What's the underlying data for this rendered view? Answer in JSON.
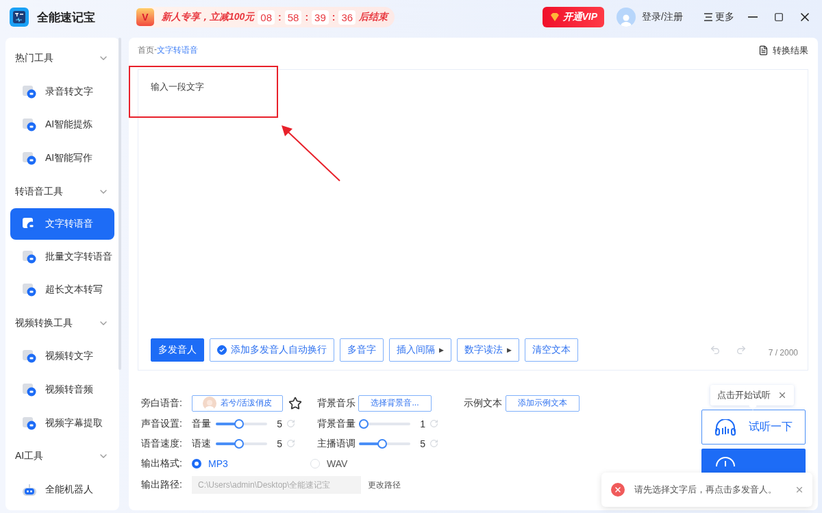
{
  "app": {
    "name": "全能速记宝"
  },
  "promo": {
    "badge": "V",
    "text": "新人专享，立减100元",
    "countdown": [
      {
        "kind": "digits",
        "text": "08"
      },
      {
        "kind": "colon",
        "text": ":"
      },
      {
        "kind": "digits",
        "text": "58"
      },
      {
        "kind": "colon",
        "text": ":"
      },
      {
        "kind": "digits",
        "text": "39"
      },
      {
        "kind": "colon",
        "text": ":"
      },
      {
        "kind": "digits",
        "text": "36"
      }
    ],
    "suffix": "后结束"
  },
  "vip_button": "开通VIP",
  "login": "登录/注册",
  "more_menu": "更多",
  "sidebar": {
    "sections": [
      {
        "title": "热门工具",
        "expanded": true,
        "items": [
          {
            "label": "录音转文字",
            "selected": false
          },
          {
            "label": "AI智能提炼",
            "selected": false
          },
          {
            "label": "AI智能写作",
            "selected": false
          }
        ]
      },
      {
        "title": "转语音工具",
        "expanded": true,
        "items": [
          {
            "label": "文字转语音",
            "selected": true
          },
          {
            "label": "批量文字转语音",
            "selected": false
          },
          {
            "label": "超长文本转写",
            "selected": false
          }
        ]
      },
      {
        "title": "视频转换工具",
        "expanded": true,
        "items": [
          {
            "label": "视频转文字",
            "selected": false
          },
          {
            "label": "视频转音频",
            "selected": false
          },
          {
            "label": "视频字幕提取",
            "selected": false
          }
        ]
      },
      {
        "title": "AI工具",
        "expanded": true,
        "items": [
          {
            "label": "全能机器人",
            "selected": false
          }
        ]
      }
    ]
  },
  "breadcrumb": {
    "home": "首页",
    "separator": "-",
    "current": "文字转语音"
  },
  "result_button": "转换结果",
  "editor": {
    "value": "输入一段文字",
    "counter": "7 / 2000",
    "undo": {
      "disabled": true
    },
    "redo": {
      "disabled": true
    },
    "toolbar": [
      {
        "kind": "primary",
        "label": "多发音人"
      },
      {
        "kind": "check",
        "label": "添加多发音人自动换行",
        "checked": true
      },
      {
        "kind": "plain",
        "label": "多音字"
      },
      {
        "kind": "menu",
        "label": "插入间隔",
        "caret": "▶"
      },
      {
        "kind": "menu",
        "label": "数字读法",
        "caret": "▶"
      },
      {
        "kind": "plain",
        "label": "清空文本"
      }
    ]
  },
  "settings": {
    "narration": {
      "label": "旁白语音:",
      "voice": "若兮/活泼俏皮",
      "favorite": false
    },
    "background_music": {
      "label": "背景音乐",
      "button": "选择背景音..."
    },
    "sample_text": {
      "label": "示例文本",
      "button": "添加示例文本"
    },
    "slider_rows": [
      {
        "label": "声音设置:",
        "sliders": [
          {
            "name": "音量",
            "level": 0.45,
            "reading": "5"
          },
          {
            "name": "背景音量",
            "level": 0,
            "reading": "1"
          }
        ]
      },
      {
        "label": "语音速度:",
        "sliders": [
          {
            "name": "语速",
            "level": 0.45,
            "reading": "5"
          },
          {
            "name": "主播语调",
            "level": 0.45,
            "reading": "5"
          }
        ]
      }
    ],
    "format": {
      "label": "输出格式:",
      "options": [
        {
          "label": "MP3",
          "selected": true
        },
        {
          "label": "WAV",
          "selected": false
        }
      ]
    },
    "path": {
      "label": "输出路径:",
      "value": "C:\\Users\\admin\\Desktop\\全能速记宝",
      "disabled": true,
      "change": "更改路径"
    }
  },
  "tooltip": {
    "text": "点击开始试听"
  },
  "listen_button": "试听一下",
  "toast": {
    "kind": "error",
    "message": "请先选择文字后，再点击多发音人。"
  }
}
